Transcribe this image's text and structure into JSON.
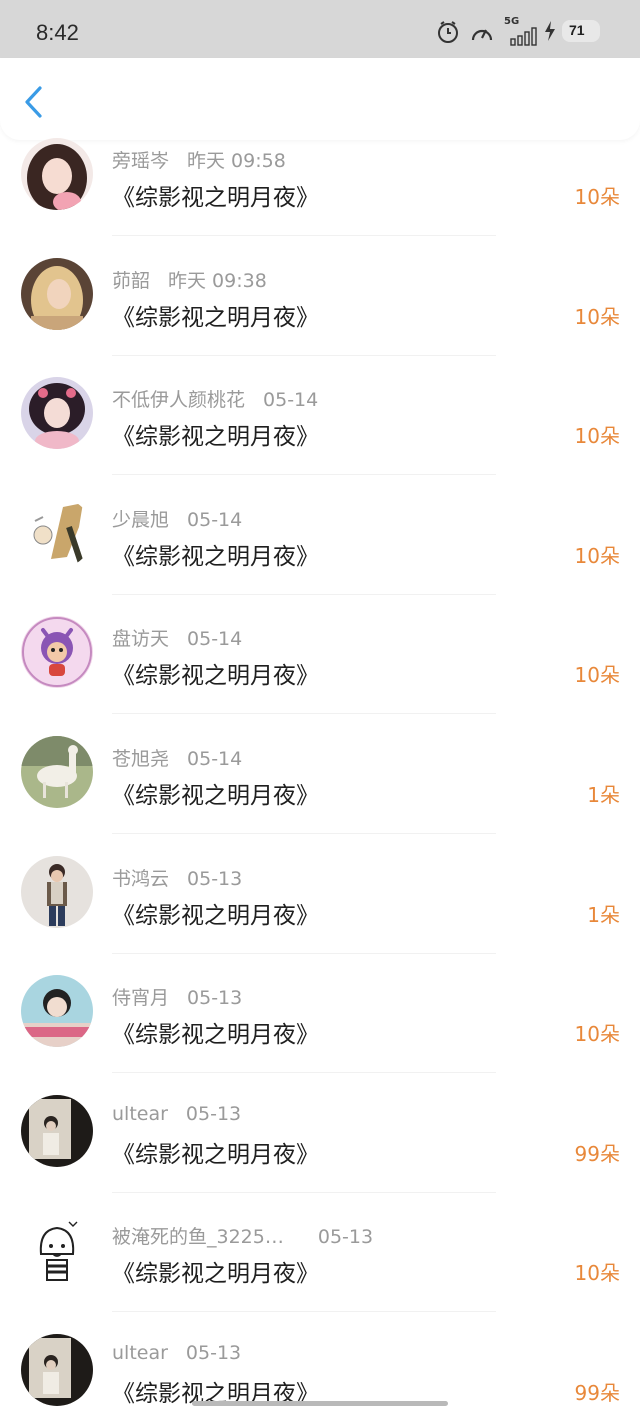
{
  "status_bar": {
    "time": "8:42",
    "network": "5G",
    "battery": "71",
    "icons": [
      "alarm-icon",
      "speedometer-icon",
      "signal-icon",
      "charging-icon",
      "battery-icon"
    ]
  },
  "nav": {
    "back_icon": "chevron-left-icon",
    "accent_color": "#3a9be6"
  },
  "colors": {
    "amount": "#e8883a",
    "meta": "#9a9a9a",
    "title": "#1f1f1f"
  },
  "items": [
    {
      "name": "旁瑶岑",
      "time": "昨天 09:58",
      "title": "《综影视之明月夜》",
      "amount": "10朵"
    },
    {
      "name": "茆韶",
      "time": "昨天 09:38",
      "title": "《综影视之明月夜》",
      "amount": "10朵"
    },
    {
      "name": "不低伊人颜桃花",
      "time": "05-14",
      "title": "《综影视之明月夜》",
      "amount": "10朵"
    },
    {
      "name": "少晨旭",
      "time": "05-14",
      "title": "《综影视之明月夜》",
      "amount": "10朵"
    },
    {
      "name": "盘访天",
      "time": "05-14",
      "title": "《综影视之明月夜》",
      "amount": "10朵"
    },
    {
      "name": "苍旭尧",
      "time": "05-14",
      "title": "《综影视之明月夜》",
      "amount": "1朵"
    },
    {
      "name": "书鸿云",
      "time": "05-13",
      "title": "《综影视之明月夜》",
      "amount": "1朵"
    },
    {
      "name": "侍宵月",
      "time": "05-13",
      "title": "《综影视之明月夜》",
      "amount": "10朵"
    },
    {
      "name": "ultear",
      "time": "05-13",
      "title": "《综影视之明月夜》",
      "amount": "99朵"
    },
    {
      "name": "被淹死的鱼_3225…",
      "time": "05-13",
      "title": "《综影视之明月夜》",
      "amount": "10朵"
    },
    {
      "name": "ultear",
      "time": "05-13",
      "title": "《综影视之明月夜》",
      "amount": "99朵"
    }
  ]
}
